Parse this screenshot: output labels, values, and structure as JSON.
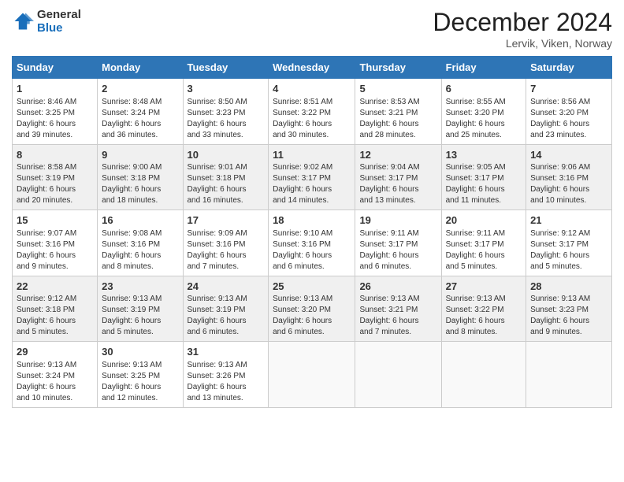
{
  "header": {
    "logo": {
      "general": "General",
      "blue": "Blue"
    },
    "month": "December 2024",
    "location": "Lervik, Viken, Norway"
  },
  "days_of_week": [
    "Sunday",
    "Monday",
    "Tuesday",
    "Wednesday",
    "Thursday",
    "Friday",
    "Saturday"
  ],
  "weeks": [
    [
      {
        "day": "1",
        "sunrise": "8:46 AM",
        "sunset": "3:25 PM",
        "daylight": "6 hours and 39 minutes."
      },
      {
        "day": "2",
        "sunrise": "8:48 AM",
        "sunset": "3:24 PM",
        "daylight": "6 hours and 36 minutes."
      },
      {
        "day": "3",
        "sunrise": "8:50 AM",
        "sunset": "3:23 PM",
        "daylight": "6 hours and 33 minutes."
      },
      {
        "day": "4",
        "sunrise": "8:51 AM",
        "sunset": "3:22 PM",
        "daylight": "6 hours and 30 minutes."
      },
      {
        "day": "5",
        "sunrise": "8:53 AM",
        "sunset": "3:21 PM",
        "daylight": "6 hours and 28 minutes."
      },
      {
        "day": "6",
        "sunrise": "8:55 AM",
        "sunset": "3:20 PM",
        "daylight": "6 hours and 25 minutes."
      },
      {
        "day": "7",
        "sunrise": "8:56 AM",
        "sunset": "3:20 PM",
        "daylight": "6 hours and 23 minutes."
      }
    ],
    [
      {
        "day": "8",
        "sunrise": "8:58 AM",
        "sunset": "3:19 PM",
        "daylight": "6 hours and 20 minutes."
      },
      {
        "day": "9",
        "sunrise": "9:00 AM",
        "sunset": "3:18 PM",
        "daylight": "6 hours and 18 minutes."
      },
      {
        "day": "10",
        "sunrise": "9:01 AM",
        "sunset": "3:18 PM",
        "daylight": "6 hours and 16 minutes."
      },
      {
        "day": "11",
        "sunrise": "9:02 AM",
        "sunset": "3:17 PM",
        "daylight": "6 hours and 14 minutes."
      },
      {
        "day": "12",
        "sunrise": "9:04 AM",
        "sunset": "3:17 PM",
        "daylight": "6 hours and 13 minutes."
      },
      {
        "day": "13",
        "sunrise": "9:05 AM",
        "sunset": "3:17 PM",
        "daylight": "6 hours and 11 minutes."
      },
      {
        "day": "14",
        "sunrise": "9:06 AM",
        "sunset": "3:16 PM",
        "daylight": "6 hours and 10 minutes."
      }
    ],
    [
      {
        "day": "15",
        "sunrise": "9:07 AM",
        "sunset": "3:16 PM",
        "daylight": "6 hours and 9 minutes."
      },
      {
        "day": "16",
        "sunrise": "9:08 AM",
        "sunset": "3:16 PM",
        "daylight": "6 hours and 8 minutes."
      },
      {
        "day": "17",
        "sunrise": "9:09 AM",
        "sunset": "3:16 PM",
        "daylight": "6 hours and 7 minutes."
      },
      {
        "day": "18",
        "sunrise": "9:10 AM",
        "sunset": "3:16 PM",
        "daylight": "6 hours and 6 minutes."
      },
      {
        "day": "19",
        "sunrise": "9:11 AM",
        "sunset": "3:17 PM",
        "daylight": "6 hours and 6 minutes."
      },
      {
        "day": "20",
        "sunrise": "9:11 AM",
        "sunset": "3:17 PM",
        "daylight": "6 hours and 5 minutes."
      },
      {
        "day": "21",
        "sunrise": "9:12 AM",
        "sunset": "3:17 PM",
        "daylight": "6 hours and 5 minutes."
      }
    ],
    [
      {
        "day": "22",
        "sunrise": "9:12 AM",
        "sunset": "3:18 PM",
        "daylight": "6 hours and 5 minutes."
      },
      {
        "day": "23",
        "sunrise": "9:13 AM",
        "sunset": "3:19 PM",
        "daylight": "6 hours and 5 minutes."
      },
      {
        "day": "24",
        "sunrise": "9:13 AM",
        "sunset": "3:19 PM",
        "daylight": "6 hours and 6 minutes."
      },
      {
        "day": "25",
        "sunrise": "9:13 AM",
        "sunset": "3:20 PM",
        "daylight": "6 hours and 6 minutes."
      },
      {
        "day": "26",
        "sunrise": "9:13 AM",
        "sunset": "3:21 PM",
        "daylight": "6 hours and 7 minutes."
      },
      {
        "day": "27",
        "sunrise": "9:13 AM",
        "sunset": "3:22 PM",
        "daylight": "6 hours and 8 minutes."
      },
      {
        "day": "28",
        "sunrise": "9:13 AM",
        "sunset": "3:23 PM",
        "daylight": "6 hours and 9 minutes."
      }
    ],
    [
      {
        "day": "29",
        "sunrise": "9:13 AM",
        "sunset": "3:24 PM",
        "daylight": "6 hours and 10 minutes."
      },
      {
        "day": "30",
        "sunrise": "9:13 AM",
        "sunset": "3:25 PM",
        "daylight": "6 hours and 12 minutes."
      },
      {
        "day": "31",
        "sunrise": "9:13 AM",
        "sunset": "3:26 PM",
        "daylight": "6 hours and 13 minutes."
      },
      null,
      null,
      null,
      null
    ]
  ],
  "labels": {
    "sunrise": "Sunrise:",
    "sunset": "Sunset:",
    "daylight": "Daylight:"
  }
}
